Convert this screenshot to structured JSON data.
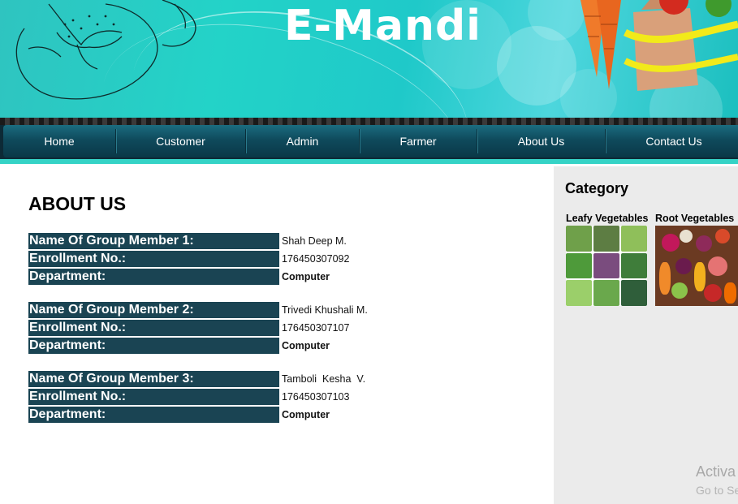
{
  "banner": {
    "title": "E-Mandi"
  },
  "nav": {
    "items": [
      {
        "label": "Home"
      },
      {
        "label": "Customer"
      },
      {
        "label": "Admin"
      },
      {
        "label": "Farmer"
      },
      {
        "label": "About Us"
      },
      {
        "label": "Contact Us"
      }
    ]
  },
  "main": {
    "title": "ABOUT US",
    "members": [
      {
        "name_label": "Name Of Group Member 1:",
        "name": "Shah Deep M.",
        "enroll_label": "Enrollment No.:",
        "enroll": "176450307092",
        "dept_label": "Department:",
        "dept": "Computer"
      },
      {
        "name_label": "Name Of Group Member 2:",
        "name": "Trivedi Khushali M.",
        "enroll_label": "Enrollment No.:",
        "enroll": "176450307107",
        "dept_label": "Department:",
        "dept": "Computer"
      },
      {
        "name_label": "Name Of Group Member 3:",
        "name": "Tamboli  Kesha  V.",
        "enroll_label": "Enrollment No.:",
        "enroll": "176450307103",
        "dept_label": "Department:",
        "dept": "Computer"
      }
    ]
  },
  "sidebar": {
    "title": "Category",
    "categories": [
      {
        "label": "Leafy Vegetables"
      },
      {
        "label": "Root Vegetables"
      }
    ]
  },
  "watermark": {
    "line1": "Activa",
    "line2": "Go to Se"
  },
  "colors": {
    "banner": "#23d3c8",
    "nav": "#0f4a5c",
    "label_bg": "#1a4453",
    "sidebar_bg": "#ebebeb",
    "accent_strip": "#35d3c6"
  }
}
